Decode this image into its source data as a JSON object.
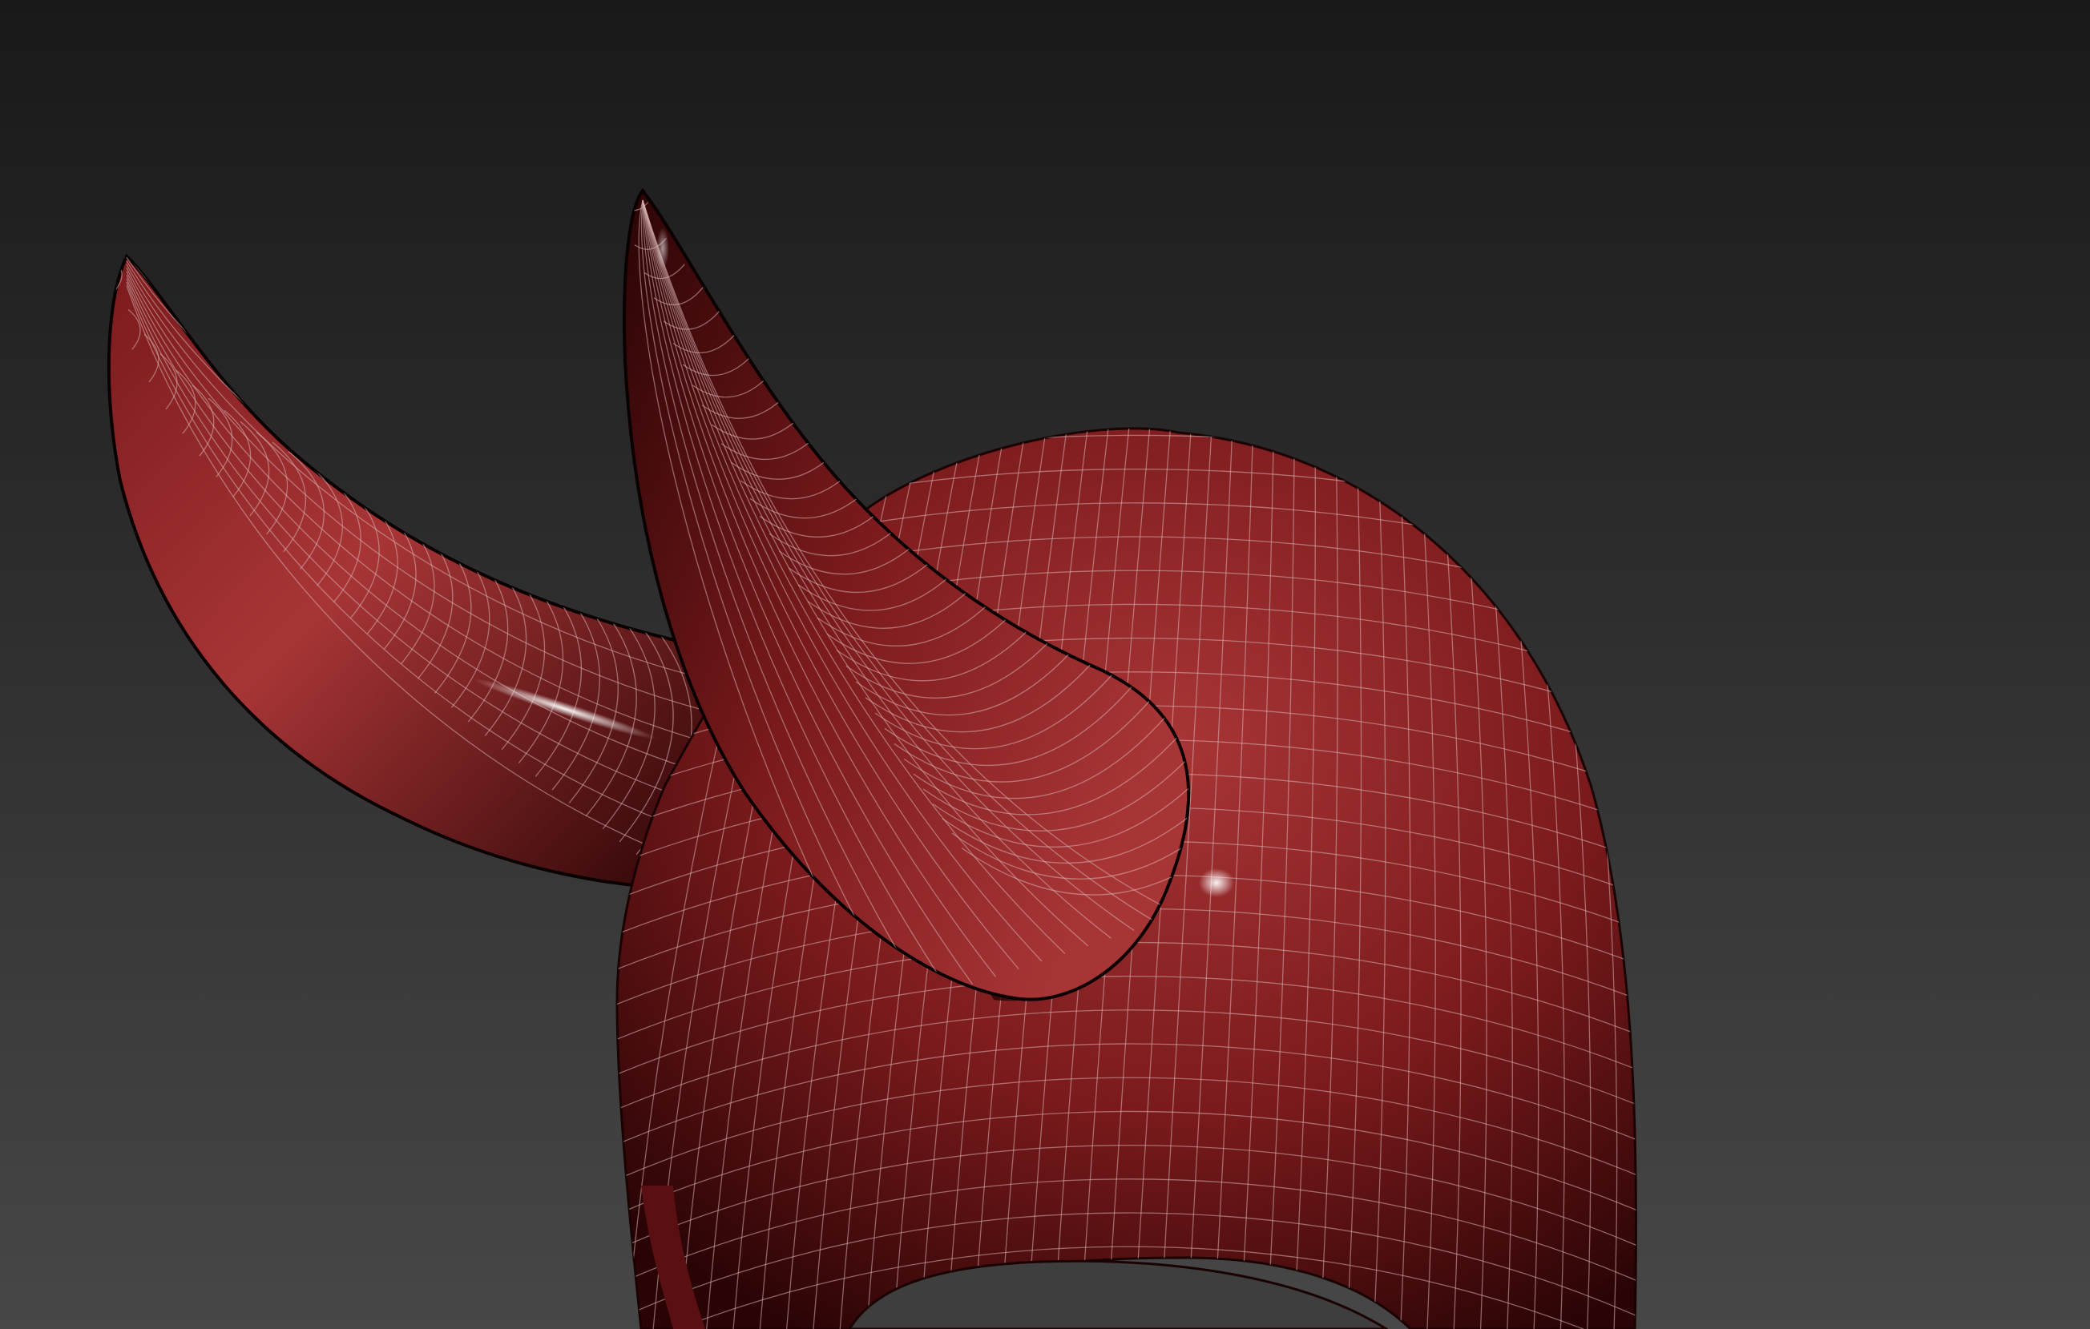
{
  "viewport": {
    "view_type": "3d-perspective-viewport",
    "shading": "smooth-with-edged-faces",
    "background_gradient": {
      "top": "#191919",
      "bottom": "#474747"
    },
    "model": {
      "object": "horned-head-mesh",
      "material_color": "#7a1a1c",
      "material_shadow_color": "#2a0405",
      "material_highlight_color": "#a83536",
      "wireframe_color": "#d8b2b2",
      "specular_color": "#ffffff"
    }
  }
}
